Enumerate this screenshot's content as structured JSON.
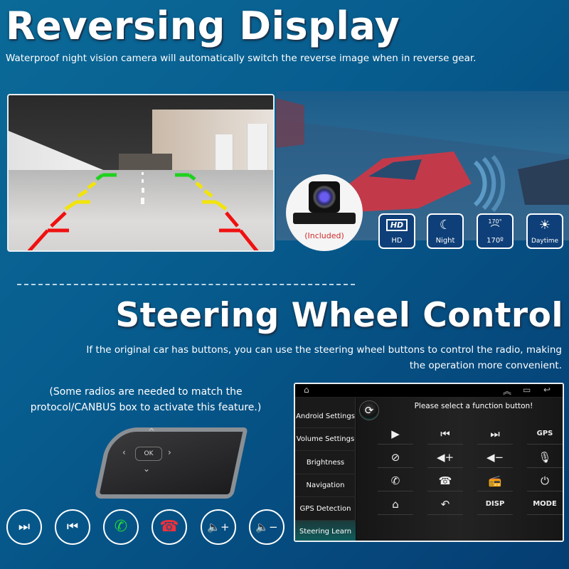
{
  "section1": {
    "title": "Reversing Display",
    "subtitle": "Waterproof night vision camera will automatically switch the reverse image when in reverse gear.",
    "camera_label": "(Included)",
    "features": [
      {
        "icon": "hd-icon",
        "glyph": "HD",
        "label": "HD"
      },
      {
        "icon": "moon-icon",
        "glyph": "☾",
        "label": "Night"
      },
      {
        "icon": "viewing-angle-icon",
        "glyph": "170°",
        "label": "170º"
      },
      {
        "icon": "sun-icon",
        "glyph": "☀",
        "label": "Daytime"
      }
    ],
    "guide_colors": {
      "near": "#f01010",
      "mid": "#f2e40a",
      "far": "#1fd11f"
    }
  },
  "section2": {
    "title": "Steering Wheel Control",
    "subtitle_line1": "If the original car has buttons, you can use the steering wheel  buttons to control the radio, making",
    "subtitle_line2": "the operation more convenient.",
    "note": "(Some radios are needed to match the protocol/CANBUS box to activate this feature.)",
    "wheel_ok": "OK",
    "round_buttons": [
      {
        "icon": "next-track-icon",
        "glyph": "⏭",
        "color": "#ffffff"
      },
      {
        "icon": "previous-track-icon",
        "glyph": "⏮",
        "color": "#ffffff"
      },
      {
        "icon": "answer-call-icon",
        "glyph": "✆",
        "color": "#22d83a"
      },
      {
        "icon": "hang-up-icon",
        "glyph": "☎",
        "color": "#f0303a"
      },
      {
        "icon": "volume-up-icon",
        "glyph": "🔈+",
        "color": "#ffffff"
      },
      {
        "icon": "volume-down-icon",
        "glyph": "🔈−",
        "color": "#ffffff"
      }
    ]
  },
  "screen": {
    "sidebar": [
      "Android Settings",
      "Volume Settings",
      "Brightness",
      "Navigation",
      "GPS Detection",
      "Steering Learn"
    ],
    "active_item": "Steering Learn",
    "prompt": "Please select a function button!",
    "functions": [
      [
        {
          "icon": "play-icon",
          "glyph": "▶"
        },
        {
          "icon": "previous-icon",
          "glyph": "⏮"
        },
        {
          "icon": "next-icon",
          "glyph": "⏭"
        },
        {
          "icon": "gps-text",
          "glyph": "GPS"
        }
      ],
      [
        {
          "icon": "mute-icon",
          "glyph": "⊘"
        },
        {
          "icon": "volume-up-icon",
          "glyph": "◀+"
        },
        {
          "icon": "volume-down-icon",
          "glyph": "◀−"
        },
        {
          "icon": "microphone-icon",
          "glyph": "🎙"
        }
      ],
      [
        {
          "icon": "phone-icon",
          "glyph": "✆"
        },
        {
          "icon": "hang-up-icon",
          "glyph": "☎"
        },
        {
          "icon": "radio-icon",
          "glyph": "📻"
        },
        {
          "icon": "power-icon",
          "glyph": "⏻"
        }
      ],
      [
        {
          "icon": "home-icon",
          "glyph": "⌂"
        },
        {
          "icon": "back-icon",
          "glyph": "↶"
        },
        {
          "icon": "disp-text",
          "glyph": "DISP"
        },
        {
          "icon": "mode-text",
          "glyph": "MODE"
        }
      ]
    ]
  }
}
